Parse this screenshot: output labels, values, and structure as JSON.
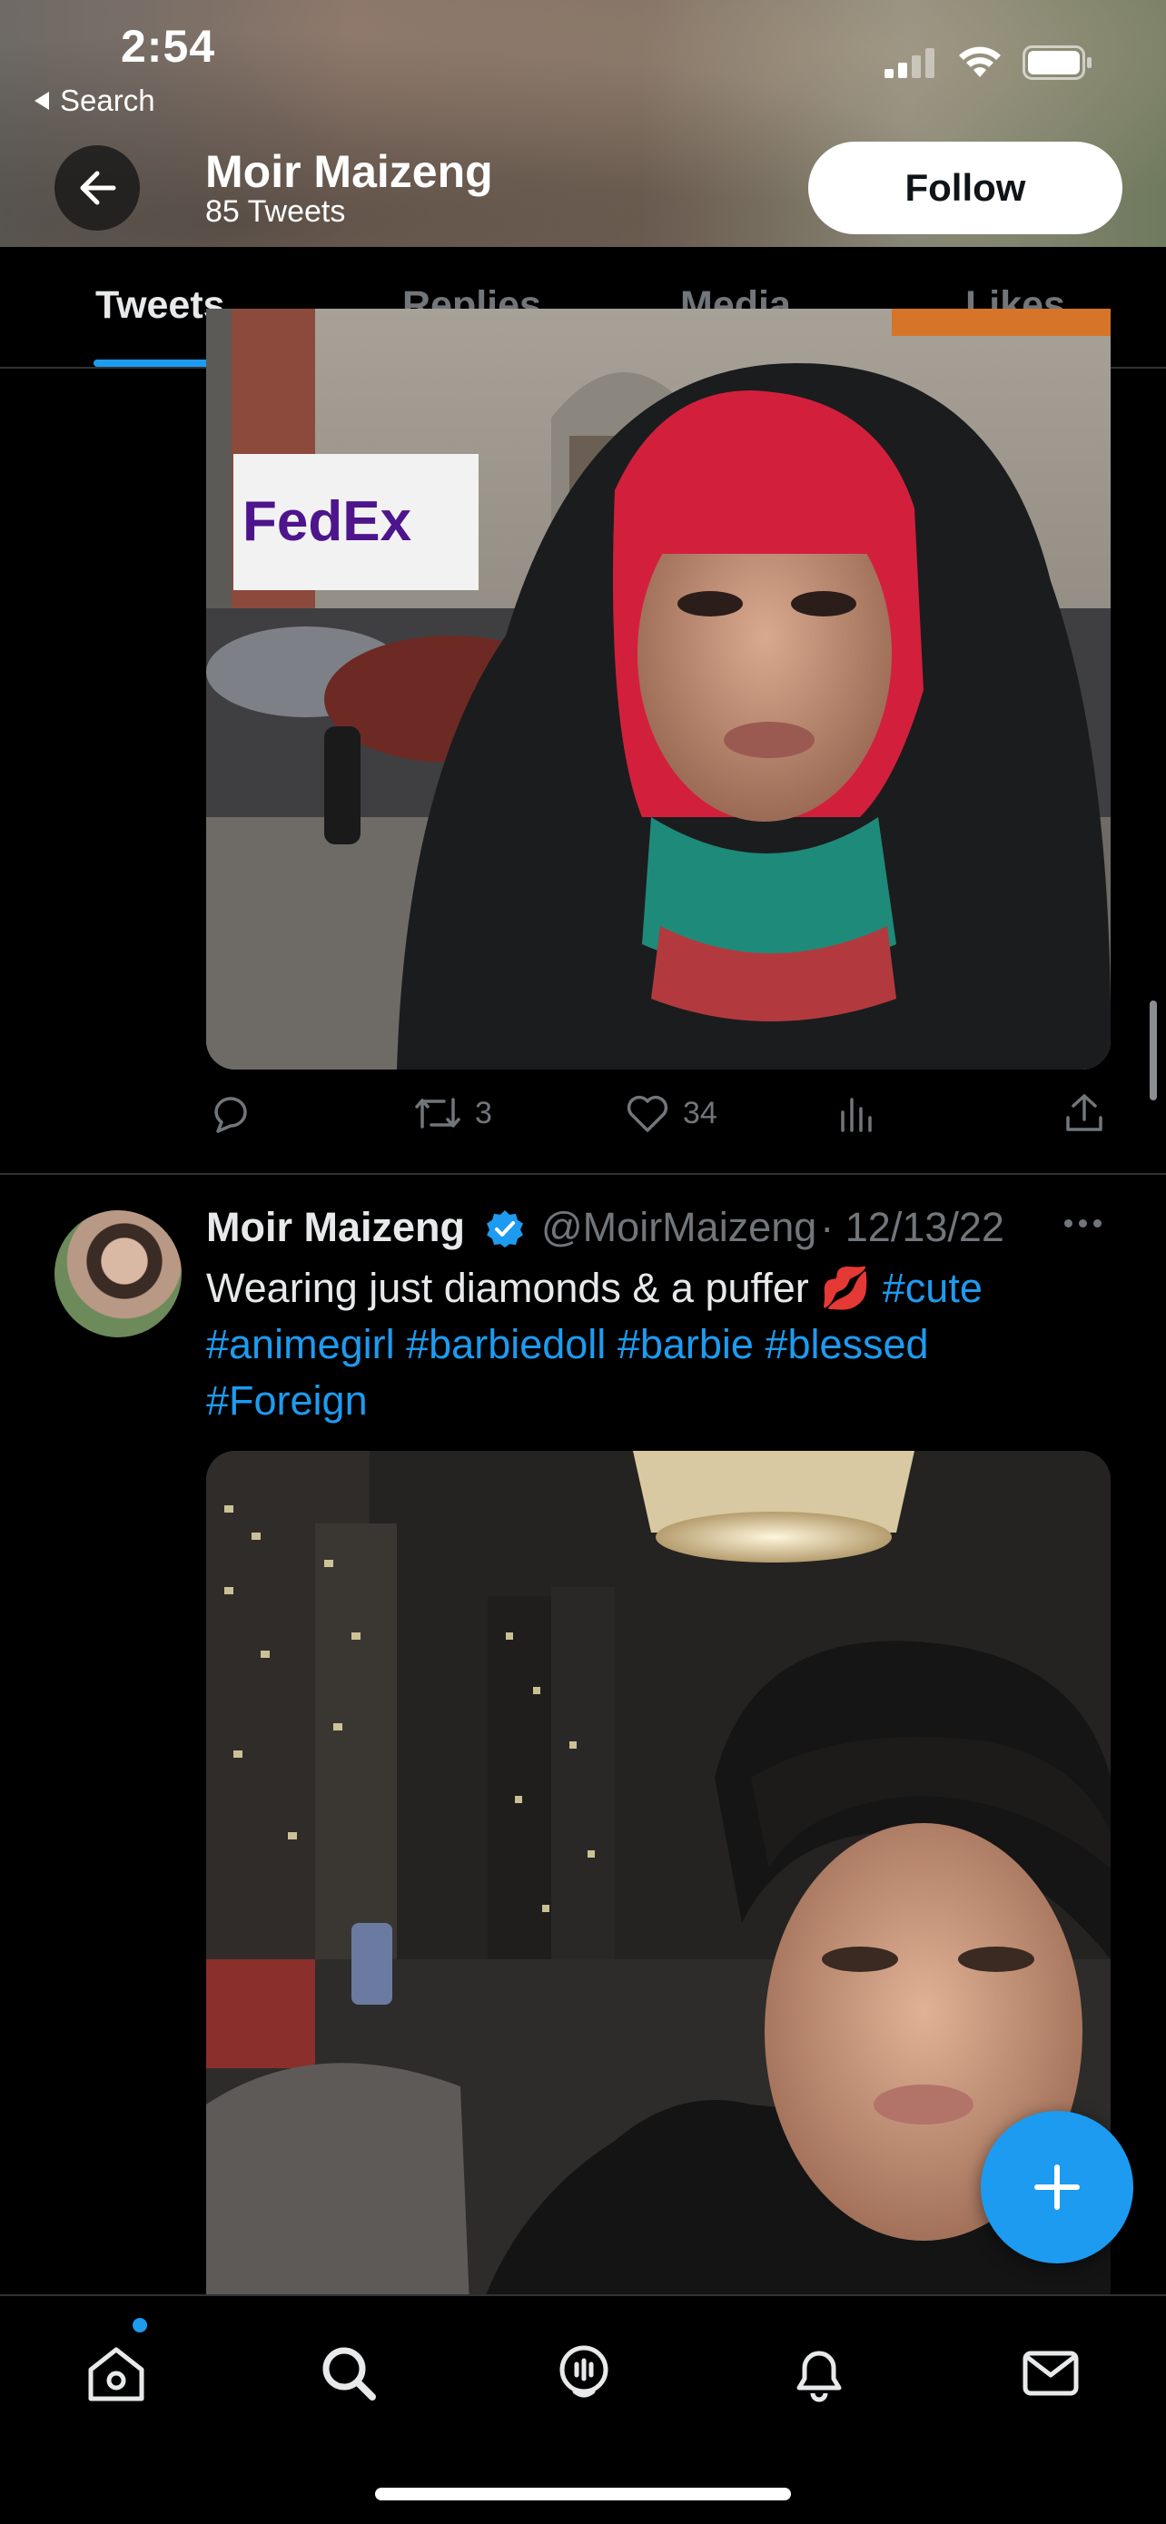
{
  "status": {
    "time": "2:54",
    "back_label": "Search"
  },
  "header": {
    "name": "Moir Maizeng",
    "tweet_count": "85 Tweets",
    "follow_label": "Follow"
  },
  "tabs": [
    {
      "label": "Tweets",
      "active": true
    },
    {
      "label": "Replies",
      "active": false
    },
    {
      "label": "Media",
      "active": false
    },
    {
      "label": "Likes",
      "active": false
    }
  ],
  "previous_tweet": {
    "retweets": "3",
    "likes": "34",
    "icons": [
      "reply-icon",
      "retweet-icon",
      "like-icon",
      "views-icon",
      "share-icon"
    ]
  },
  "tweet": {
    "author": "Moir Maizeng",
    "handle": "@MoirMaizeng",
    "date": "· 12/13/22",
    "text": "Wearing just diamonds & a puffer 💋",
    "hashtags_line1": [
      "#cute"
    ],
    "hashtags_line2": [
      "#animegirl",
      "#barbiedoll",
      "#barbie",
      "#blessed"
    ],
    "hashtags_line3": [
      "#Foreign"
    ],
    "h1": "#cute",
    "h2": "#animegirl",
    "h3": "#barbiedoll",
    "h4": "#barbie",
    "h5": "#blessed",
    "h6": "#Foreign"
  },
  "photo1_sign": "FedEx",
  "colors": {
    "accent": "#1d9bf0",
    "muted": "#71767b",
    "text": "#e7e9ea",
    "divider": "#2f3336"
  },
  "bottom_nav": [
    "home-icon",
    "search-icon",
    "spaces-icon",
    "notifications-icon",
    "messages-icon"
  ]
}
